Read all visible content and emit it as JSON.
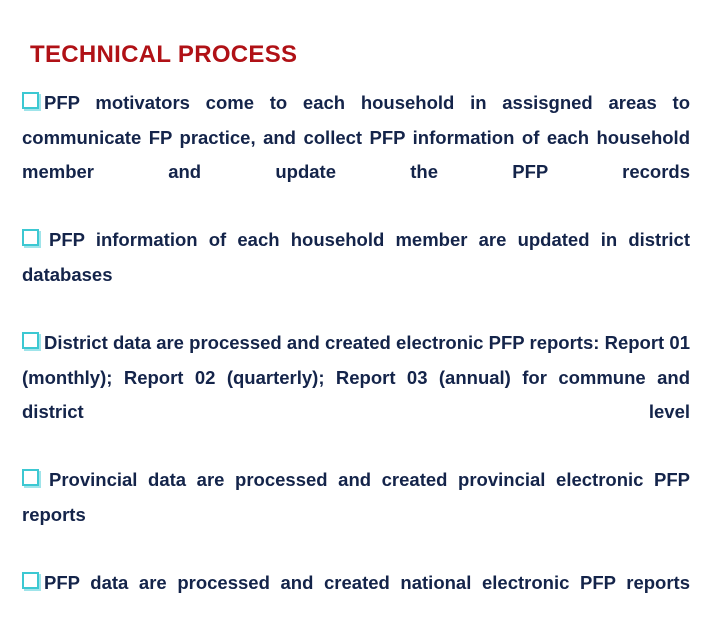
{
  "slide": {
    "title": "TECHNICAL PROCESS",
    "title_color": "#B01116",
    "body_color": "#14244A",
    "bullet_color": "#3CC8D2",
    "background_color": "#FFFFFF",
    "bullet_icon": "hollow-square-bullet",
    "bullets": [
      {
        "text": "PFP motivators come to each household in assisgned areas to communicate FP practice, and collect PFP information of each household member and update the PFP records"
      },
      {
        "text": "PFP information of each household member are updated in district databases"
      },
      {
        "text": "District data are processed and created electronic PFP reports: Report 01 (monthly); Report 02 (quarterly); Report 03 (annual) for commune and district level"
      },
      {
        "text": "Provincial data are processed and created provincial electronic PFP reports"
      },
      {
        "text": "PFP data are processed and created national electronic PFP reports"
      }
    ]
  }
}
